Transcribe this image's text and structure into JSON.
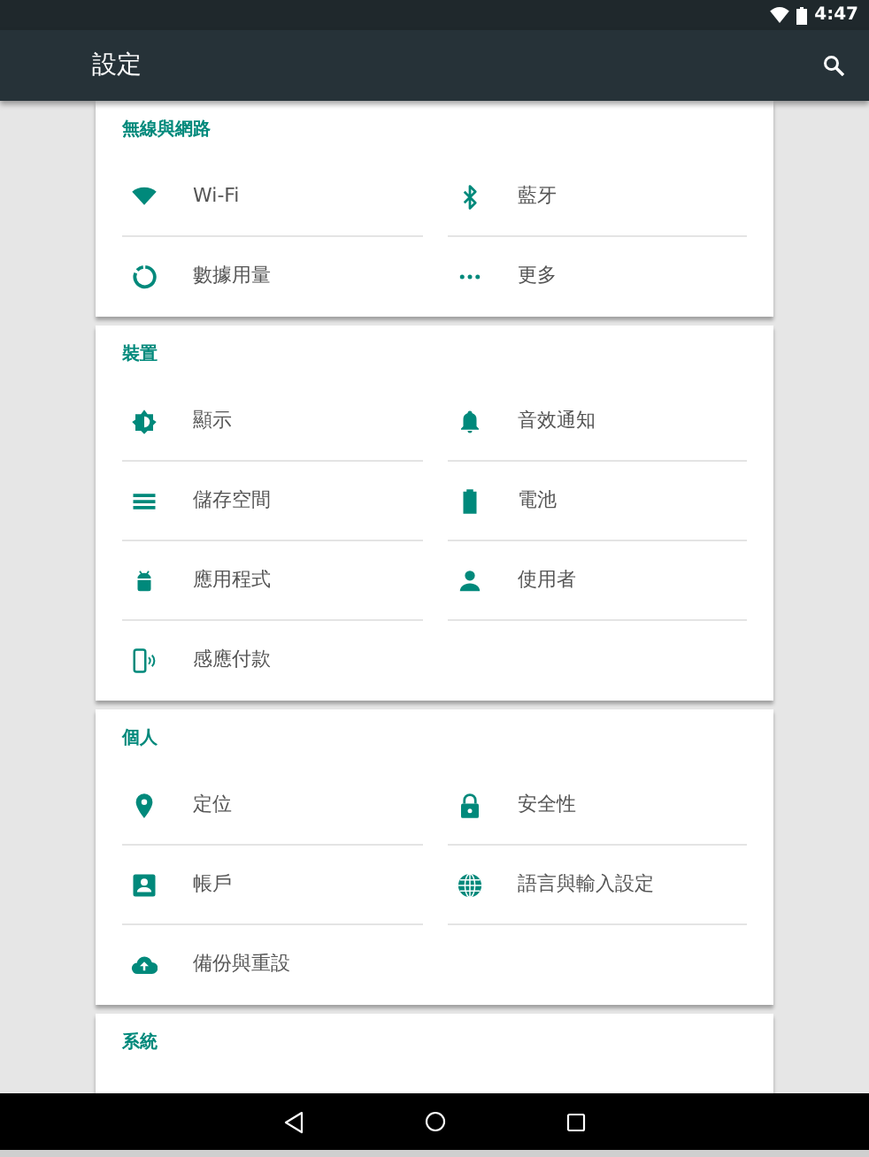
{
  "status_bar": {
    "time": "4:47"
  },
  "app_bar": {
    "title": "設定"
  },
  "sections": [
    {
      "title": "無線與網路",
      "items": [
        {
          "label": "Wi-Fi"
        },
        {
          "label": "藍牙"
        },
        {
          "label": "數據用量"
        },
        {
          "label": "更多"
        }
      ]
    },
    {
      "title": "裝置",
      "items": [
        {
          "label": "顯示"
        },
        {
          "label": "音效通知"
        },
        {
          "label": "儲存空間"
        },
        {
          "label": "電池"
        },
        {
          "label": "應用程式"
        },
        {
          "label": "使用者"
        },
        {
          "label": "感應付款"
        }
      ]
    },
    {
      "title": "個人",
      "items": [
        {
          "label": "定位"
        },
        {
          "label": "安全性"
        },
        {
          "label": "帳戶"
        },
        {
          "label": "語言與輸入設定"
        },
        {
          "label": "備份與重設"
        }
      ]
    },
    {
      "title": "系統"
    }
  ]
}
